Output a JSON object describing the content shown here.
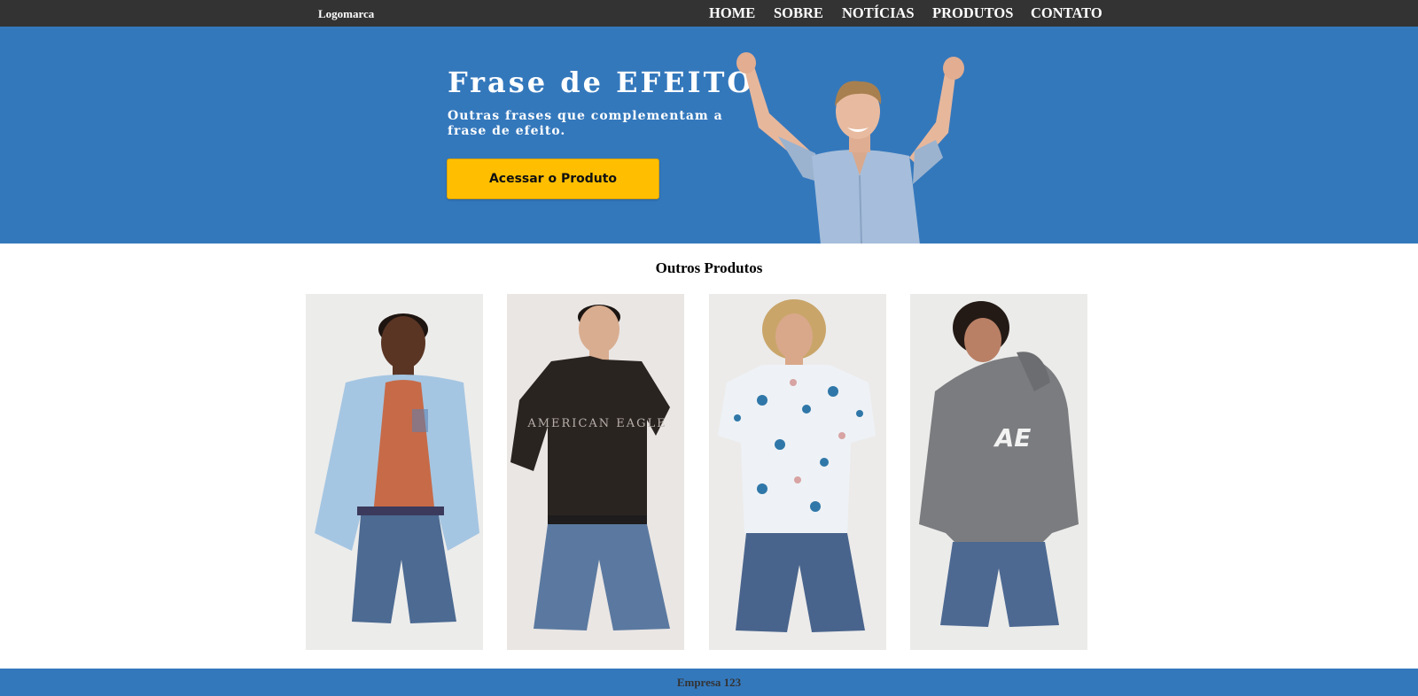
{
  "header": {
    "logo": "Logomarca",
    "nav": [
      {
        "label": "HOME"
      },
      {
        "label": "SOBRE"
      },
      {
        "label": "NOTÍCIAS"
      },
      {
        "label": "PRODUTOS"
      },
      {
        "label": "CONTATO"
      }
    ]
  },
  "hero": {
    "title": "Frase de EFEITO",
    "subtitle": "Outras frases que complementam a frase de efeito.",
    "button_label": "Acessar o Produto",
    "image": "man-celebrating-photo"
  },
  "products": {
    "title": "Outros Produtos",
    "items": [
      {
        "image": "model-light-blue-bomber-jacket-photo",
        "print": ""
      },
      {
        "image": "model-black-tshirt-photo",
        "print": "AMERICAN EAGLE"
      },
      {
        "image": "model-floral-shirt-photo",
        "print": ""
      },
      {
        "image": "model-gray-hoodie-photo",
        "print": "AE"
      }
    ]
  },
  "footer": {
    "text": "Empresa 123"
  },
  "colors": {
    "topbar": "#333333",
    "hero_background": "#3478bc",
    "button": "#ffbf00",
    "footer": "#3478bc"
  }
}
